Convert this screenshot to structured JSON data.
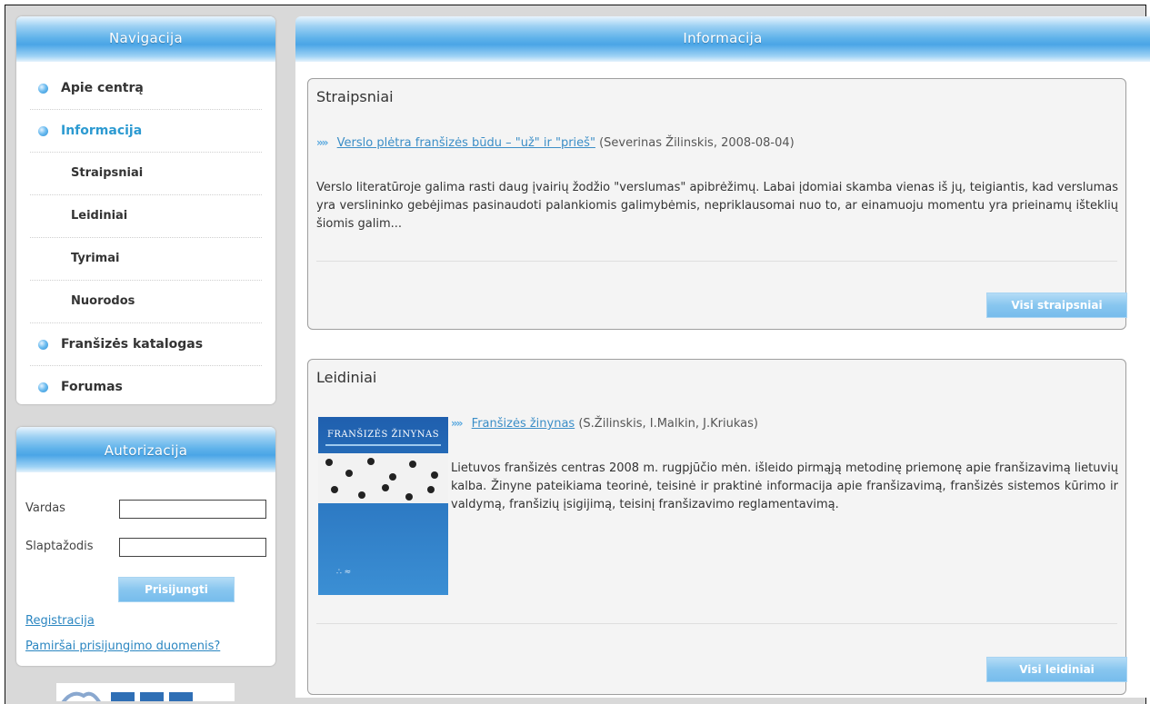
{
  "nav": {
    "title": "Navigacija",
    "items": [
      {
        "label": "Apie centrą",
        "level": "top",
        "active": false
      },
      {
        "label": "Informacija",
        "level": "top",
        "active": true
      },
      {
        "label": "Straipsniai",
        "level": "sub",
        "active": false
      },
      {
        "label": "Leidiniai",
        "level": "sub",
        "active": false
      },
      {
        "label": "Tyrimai",
        "level": "sub",
        "active": false
      },
      {
        "label": "Nuorodos",
        "level": "sub",
        "active": false
      },
      {
        "label": "Franšizės katalogas",
        "level": "top",
        "active": false
      },
      {
        "label": "Forumas",
        "level": "top",
        "active": false
      }
    ]
  },
  "auth": {
    "title": "Autorizacija",
    "username_label": "Vardas",
    "username_value": "",
    "password_label": "Slaptažodis",
    "password_value": "",
    "login_button": "Prisijungti",
    "register_link": "Registracija",
    "forgot_link": "Pamiršai prisijungimo duomenis?"
  },
  "main": {
    "title": "Informacija",
    "articles": {
      "title": "Straipsniai",
      "item_link": "Verslo plėtra franšizės būdu – \"už\" ir \"prieš\"",
      "item_meta": "(Severinas Žilinskis, 2008-08-04)",
      "excerpt": "Verslo literatūroje galima rasti daug įvairių žodžio \"verslumas\" apibrėžimų. Labai įdomiai skamba vienas iš jų, teigiantis, kad verslumas yra verslininko gebėjimas pasinaudoti palankiomis galimybėmis, nepriklausomai nuo to, ar einamuoju momentu yra prieinamų išteklių šiomis galim...",
      "button": "Visi straipsniai"
    },
    "publications": {
      "title": "Leidiniai",
      "cover_title": "FRANŠIZĖS ŽINYNAS",
      "item_link": "Franšizės žinynas",
      "item_meta": "(S.Žilinskis, I.Malkin, J.Kriukas)",
      "excerpt": "Lietuvos franšizės centras 2008 m. rugpjūčio mėn. išleido pirmąją metodinę priemonę apie franšizavimą lietuvių kalba. Žinyne pateikiama teorinė, teisinė ir praktinė informacija apie franšizavimą, franšizės sistemos kūrimo ir valdymą, franšizių įsigijimą, teisinį franšizavimo reglamentavimą.",
      "button": "Visi leidiniai"
    }
  },
  "colors": {
    "accent": "#4aa5e6",
    "link": "#3b8ec7",
    "active_nav": "#2c9ad1",
    "frame_bg": "#d9d9d9"
  }
}
